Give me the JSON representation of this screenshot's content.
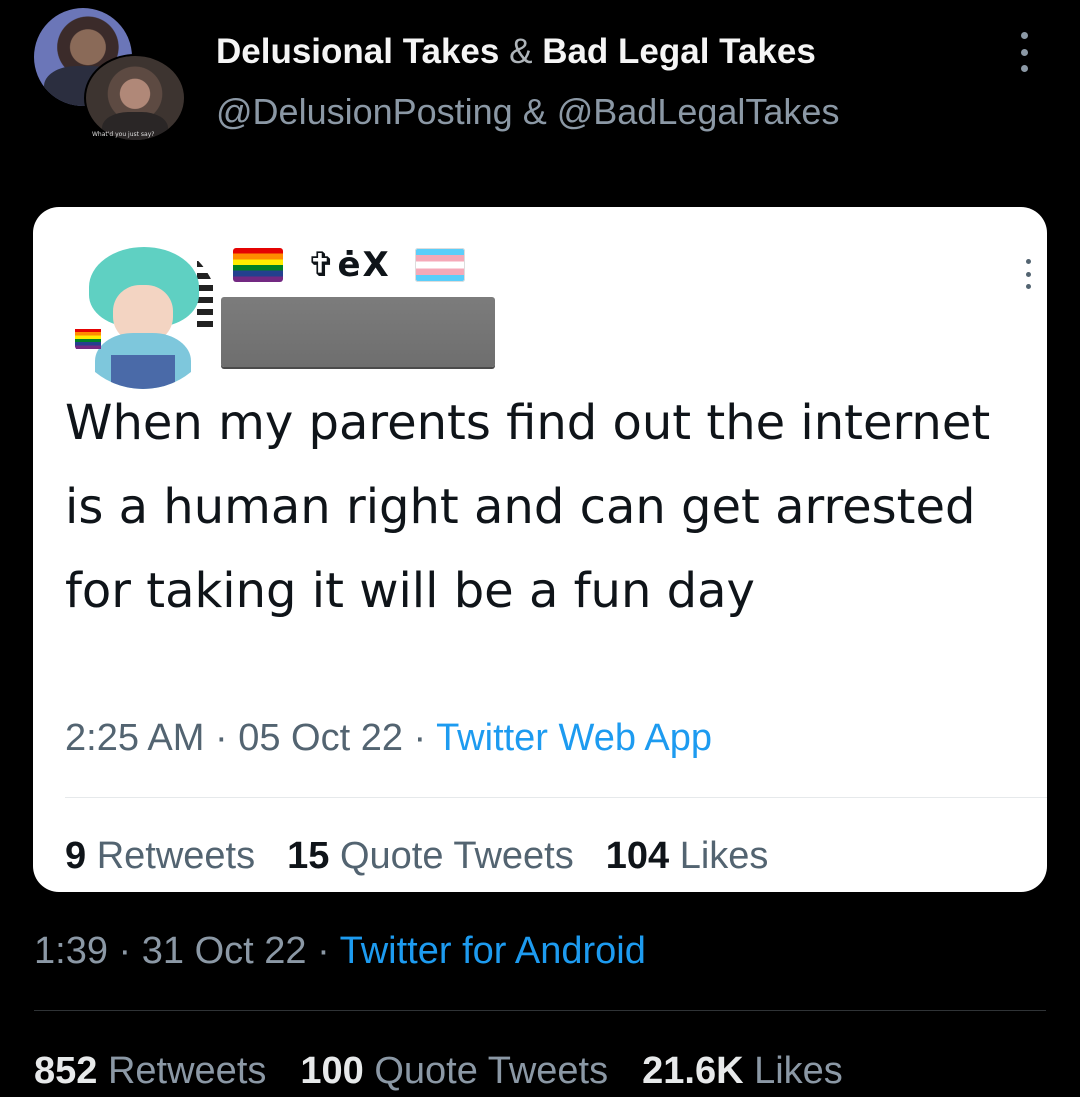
{
  "header": {
    "name_1": "Delusional Takes",
    "name_sep": "&",
    "name_2": "Bad Legal Takes",
    "handles": "@DelusionPosting & @BadLegalTakes",
    "avatar_caption": "What'd you just say?"
  },
  "quoted_tweet": {
    "display_name": "✞ėX",
    "text": "When my parents find out the internet is a human right and can get arrested for taking it will be a fun day",
    "time": "2:25 AM",
    "date": "05 Oct 22",
    "source": "Twitter Web App",
    "stats": {
      "retweets_count": "9",
      "retweets_label": "Retweets",
      "quotes_count": "15",
      "quotes_label": "Quote Tweets",
      "likes_count": "104",
      "likes_label": "Likes"
    }
  },
  "tweet_meta": {
    "time": "1:39",
    "date": "31 Oct 22",
    "source": "Twitter for Android"
  },
  "tweet_stats": {
    "retweets_count": "852",
    "retweets_label": "Retweets",
    "quotes_count": "100",
    "quotes_label": "Quote Tweets",
    "likes_count": "21.6K",
    "likes_label": "Likes"
  },
  "colors": {
    "background": "#000000",
    "card": "#ffffff",
    "link": "#1d9bf0",
    "muted": "#8b98a5"
  },
  "icons": [
    "more-options-icon",
    "rainbow-flag-icon",
    "trans-flag-icon"
  ]
}
